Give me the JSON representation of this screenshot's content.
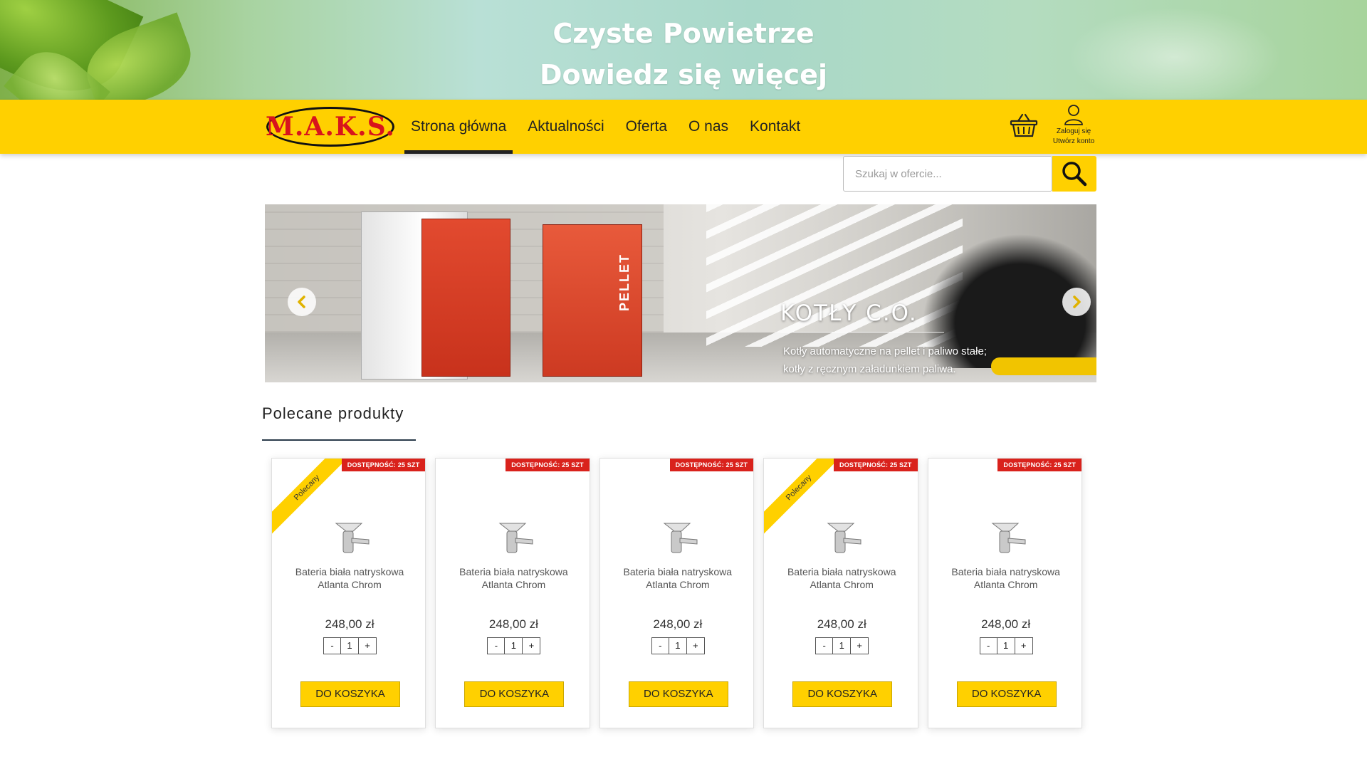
{
  "banner": {
    "line1": "Czyste Powietrze",
    "line2": "Dowiedz się więcej"
  },
  "brand": {
    "logo_text": "M.A.K.S.",
    "accent_color": "#ffd000",
    "logo_red": "#d8141c"
  },
  "nav": {
    "items": [
      {
        "label": "Strona główna",
        "active": true
      },
      {
        "label": "Aktualności",
        "active": false
      },
      {
        "label": "Oferta",
        "active": false
      },
      {
        "label": "O nas",
        "active": false
      },
      {
        "label": "Kontakt",
        "active": false
      }
    ]
  },
  "account": {
    "login": "Zaloguj się",
    "register": "Utwórz konto"
  },
  "search": {
    "placeholder": "Szukaj w ofercie..."
  },
  "slider": {
    "title": "KOTŁY C.O.",
    "desc_line1": "Kotły automatyczne na pellet i paliwo stałe;",
    "desc_line2": "kotły z ręcznym załadunkiem paliwa.",
    "boiler_label": "PELLET"
  },
  "featured": {
    "title": "Polecane produkty",
    "products": [
      {
        "name_line1": "Bateria biała natryskowa",
        "name_line2": "Atlanta Chrom",
        "price": "248,00 zł",
        "qty": "1",
        "stock": "DOSTĘPNOŚĆ: 25 SZT",
        "ribbon": "Polecany",
        "button": "DO KOSZYKA"
      },
      {
        "name_line1": "Bateria biała natryskowa",
        "name_line2": "Atlanta Chrom",
        "price": "248,00 zł",
        "qty": "1",
        "stock": "DOSTĘPNOŚĆ: 25 SZT",
        "ribbon": "",
        "button": "DO KOSZYKA"
      },
      {
        "name_line1": "Bateria biała natryskowa",
        "name_line2": "Atlanta Chrom",
        "price": "248,00 zł",
        "qty": "1",
        "stock": "DOSTĘPNOŚĆ: 25 SZT",
        "ribbon": "",
        "button": "DO KOSZYKA"
      },
      {
        "name_line1": "Bateria biała natryskowa",
        "name_line2": "Atlanta Chrom",
        "price": "248,00 zł",
        "qty": "1",
        "stock": "DOSTĘPNOŚĆ: 25 SZT",
        "ribbon": "Polecany",
        "button": "DO KOSZYKA"
      },
      {
        "name_line1": "Bateria biała natryskowa",
        "name_line2": "Atlanta Chrom",
        "price": "248,00 zł",
        "qty": "1",
        "stock": "DOSTĘPNOŚĆ: 25 SZT",
        "ribbon": "",
        "button": "DO KOSZYKA"
      }
    ],
    "qty_minus": "-",
    "qty_plus": "+"
  },
  "icons": {
    "cart": "basket-icon",
    "user": "user-icon",
    "search": "search-icon",
    "prev": "chevron-left-icon",
    "next": "chevron-right-icon"
  }
}
